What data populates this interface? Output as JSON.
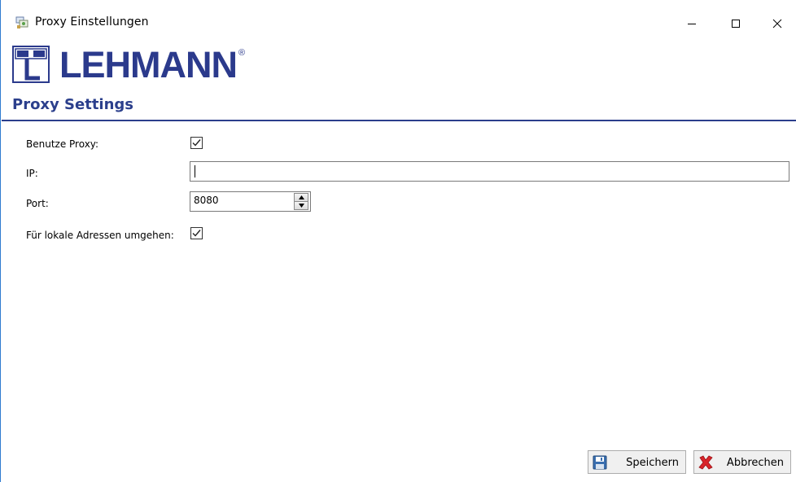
{
  "window": {
    "title": "Proxy Einstellungen",
    "controls": {
      "minimize": "minimize",
      "maximize": "maximize",
      "close": "close"
    }
  },
  "logo": {
    "text": "LEHMANN",
    "mark_text": "M M L",
    "registered": "®"
  },
  "page": {
    "title": "Proxy Settings"
  },
  "form": {
    "use_proxy": {
      "label": "Benutze Proxy:",
      "checked": true
    },
    "ip": {
      "label": "IP:",
      "value": ""
    },
    "port": {
      "label": "Port:",
      "value": "8080"
    },
    "bypass_local": {
      "label": "Für lokale Adressen umgehen:",
      "checked": true
    }
  },
  "buttons": {
    "save": "Speichern",
    "cancel": "Abbrechen"
  },
  "colors": {
    "brand": "#2b3a8c",
    "heading": "#2b3f8c",
    "window_border": "#2f7bd0",
    "cancel_icon": "#d9252b"
  },
  "icons": {
    "app": "network-settings-icon",
    "save": "save-icon",
    "cancel": "cancel-x-icon",
    "check": "check-icon",
    "spin_up": "chevron-up-icon",
    "spin_down": "chevron-down-icon"
  }
}
